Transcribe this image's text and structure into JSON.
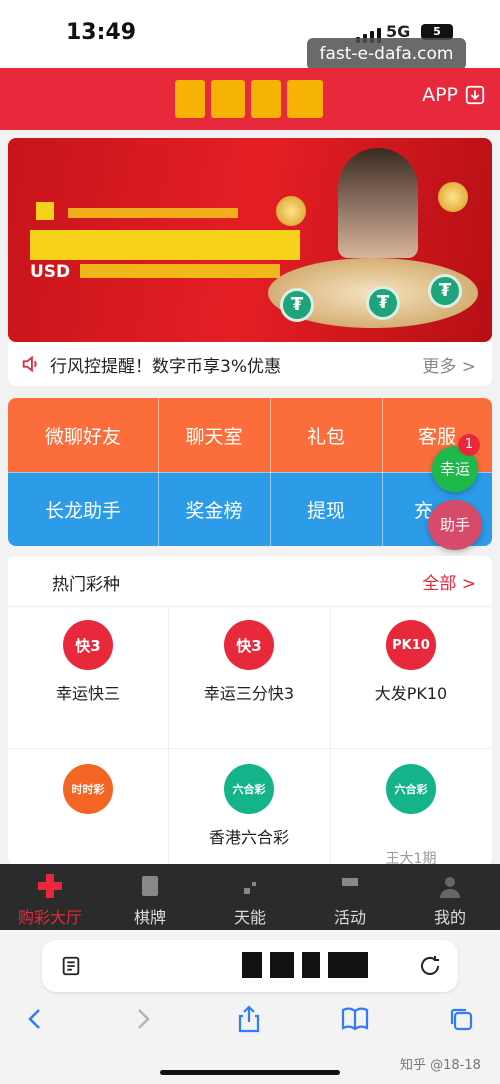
{
  "status_bar": {
    "time": "13:49",
    "network": "5G",
    "battery": "5"
  },
  "url_chip": "fast-e-dafa.com",
  "header": {
    "app_label": "APP"
  },
  "banner": {
    "currency_text": "USD"
  },
  "notice": {
    "text": "行风控提醒！数字币享3%优惠",
    "more_label": "更多 >"
  },
  "grid": {
    "items": [
      {
        "label": "微聊好友",
        "color": "#fb6e3b"
      },
      {
        "label": "聊天室",
        "color": "#fb6e3b"
      },
      {
        "label": "礼包",
        "color": "#fb6e3b"
      },
      {
        "label": "客服",
        "color": "#fb6e3b"
      },
      {
        "label": "长龙助手",
        "color": "#2c9be8"
      },
      {
        "label": "奖金榜",
        "color": "#2c9be8"
      },
      {
        "label": "提现",
        "color": "#2c9be8"
      },
      {
        "label": "充",
        "color": "#2c9be8"
      }
    ]
  },
  "floating": {
    "lucky_label": "幸运",
    "lucky_badge": "1",
    "helper_label": "助手"
  },
  "hot_lottery": {
    "title": "热门彩种",
    "all_label": "全部 >",
    "games": [
      {
        "name": "幸运快三",
        "icon_text": "快3",
        "icon_color": "#e8283b",
        "sub": ""
      },
      {
        "name": "幸运三分快3",
        "icon_text": "快3",
        "icon_color": "#e8283b",
        "sub": ""
      },
      {
        "name": "大发PK10",
        "icon_text": "PK10",
        "icon_color": "#e8283b",
        "sub": ""
      },
      {
        "name": "",
        "icon_text": "时时彩",
        "icon_color": "#f26522",
        "sub": ""
      },
      {
        "name": "香港六合彩",
        "icon_text": "六合彩",
        "icon_color": "#14b38a",
        "sub": ""
      },
      {
        "name": "",
        "icon_text": "六合彩",
        "icon_color": "#14b38a",
        "sub": "王大1期"
      }
    ]
  },
  "tabbar": {
    "items": [
      {
        "label": "购彩大厅",
        "active": true
      },
      {
        "label": "棋牌",
        "active": false
      },
      {
        "label": "天能",
        "active": false
      },
      {
        "label": "活动",
        "active": false
      },
      {
        "label": "我的",
        "active": false
      }
    ]
  },
  "watermark": "知乎 @18-18"
}
